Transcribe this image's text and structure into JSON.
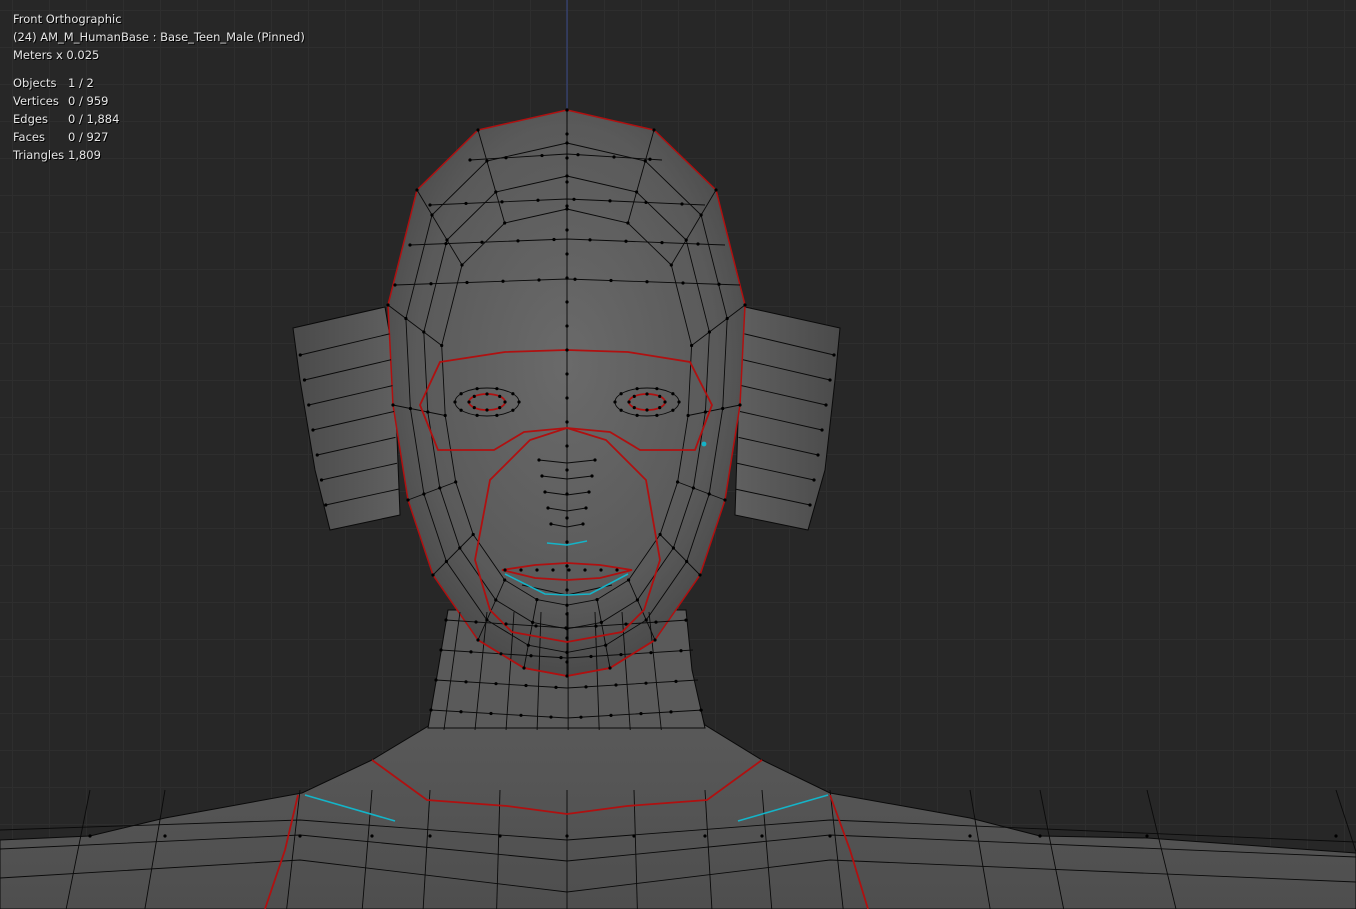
{
  "viewport": {
    "view_name": "Front Orthographic",
    "object_info": "(24) AM_M_HumanBase : Base_Teen_Male (Pinned)",
    "scale_info": "Meters x 0.025"
  },
  "stats": [
    {
      "label": "Objects",
      "value": "1 / 2"
    },
    {
      "label": "Vertices",
      "value": "0 / 959"
    },
    {
      "label": "Edges",
      "value": "0 / 1,884"
    },
    {
      "label": "Faces",
      "value": "0 / 927"
    },
    {
      "label": "Triangles",
      "value": "1,809"
    }
  ],
  "colors": {
    "background": "#272727",
    "grid": "#2e2e2e",
    "mesh_face": "#5c5c5c",
    "wire": "#0a0a0a",
    "seam": "#b01010",
    "sharp": "#14b4c8",
    "z_axis": "#3a4a8a"
  }
}
